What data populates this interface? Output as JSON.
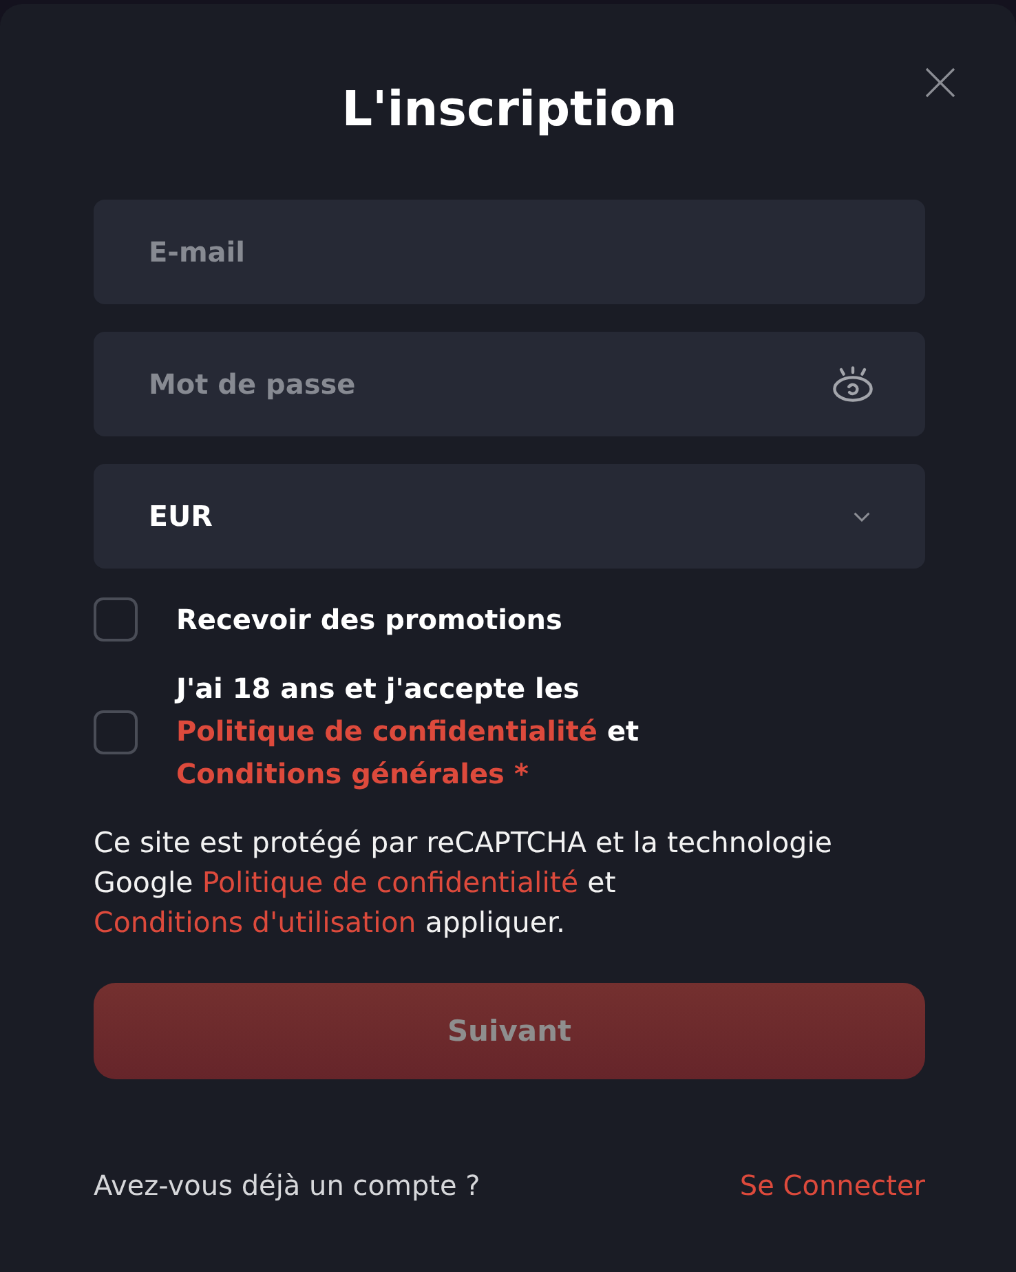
{
  "dialog": {
    "title": "L'inscription"
  },
  "fields": [
    {
      "kind": "email",
      "placeholder": "E-mail"
    },
    {
      "kind": "password",
      "placeholder": "Mot de passe"
    },
    {
      "kind": "select",
      "value": "EUR"
    }
  ],
  "checkboxes": [
    {
      "checked": false,
      "label": [
        {
          "kind": "text",
          "text": "Recevoir des promotions"
        }
      ]
    },
    {
      "checked": false,
      "label": [
        {
          "kind": "text",
          "text": "J'ai 18 ans et j'accepte les"
        },
        {
          "kind": "link",
          "text": "Politique de confidentialité"
        },
        {
          "kind": "text",
          "text": "et"
        },
        {
          "kind": "link",
          "text": "Conditions générales"
        },
        {
          "kind": "required",
          "text": "*"
        }
      ]
    }
  ],
  "notice": [
    {
      "kind": "text",
      "text": "Ce site est protégé par reCAPTCHA et la technologie Google"
    },
    {
      "kind": "link",
      "text": "Politique de confidentialité"
    },
    {
      "kind": "text",
      "text": "et"
    },
    {
      "kind": "link",
      "text": "Conditions d'utilisation"
    },
    {
      "kind": "text",
      "text": "appliquer."
    }
  ],
  "submit_button": {
    "label": "Suivant",
    "disabled": true
  },
  "footer": {
    "prompt": "Avez-vous déjà un compte ?",
    "link": "Se Connecter"
  }
}
